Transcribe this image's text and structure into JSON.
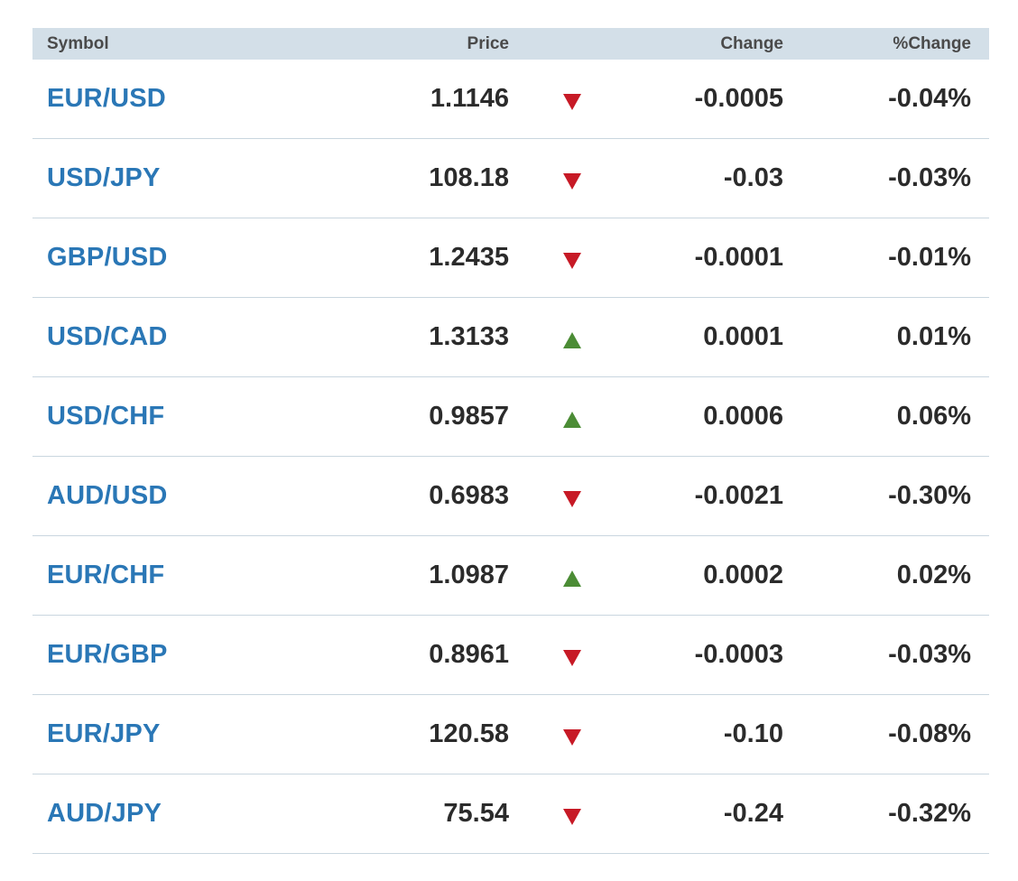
{
  "header": {
    "symbol": "Symbol",
    "price": "Price",
    "change": "Change",
    "pct_change": "%Change"
  },
  "colors": {
    "header_bg": "#d3dfe8",
    "symbol_link": "#2a77b6",
    "down": "#c71a26",
    "up": "#4b8c35"
  },
  "rows": [
    {
      "symbol": "EUR/USD",
      "price": "1.1146",
      "direction": "down",
      "change": "-0.0005",
      "pct": "-0.04%"
    },
    {
      "symbol": "USD/JPY",
      "price": "108.18",
      "direction": "down",
      "change": "-0.03",
      "pct": "-0.03%"
    },
    {
      "symbol": "GBP/USD",
      "price": "1.2435",
      "direction": "down",
      "change": "-0.0001",
      "pct": "-0.01%"
    },
    {
      "symbol": "USD/CAD",
      "price": "1.3133",
      "direction": "up",
      "change": "0.0001",
      "pct": "0.01%"
    },
    {
      "symbol": "USD/CHF",
      "price": "0.9857",
      "direction": "up",
      "change": "0.0006",
      "pct": "0.06%"
    },
    {
      "symbol": "AUD/USD",
      "price": "0.6983",
      "direction": "down",
      "change": "-0.0021",
      "pct": "-0.30%"
    },
    {
      "symbol": "EUR/CHF",
      "price": "1.0987",
      "direction": "up",
      "change": "0.0002",
      "pct": "0.02%"
    },
    {
      "symbol": "EUR/GBP",
      "price": "0.8961",
      "direction": "down",
      "change": "-0.0003",
      "pct": "-0.03%"
    },
    {
      "symbol": "EUR/JPY",
      "price": "120.58",
      "direction": "down",
      "change": "-0.10",
      "pct": "-0.08%"
    },
    {
      "symbol": "AUD/JPY",
      "price": "75.54",
      "direction": "down",
      "change": "-0.24",
      "pct": "-0.32%"
    }
  ]
}
